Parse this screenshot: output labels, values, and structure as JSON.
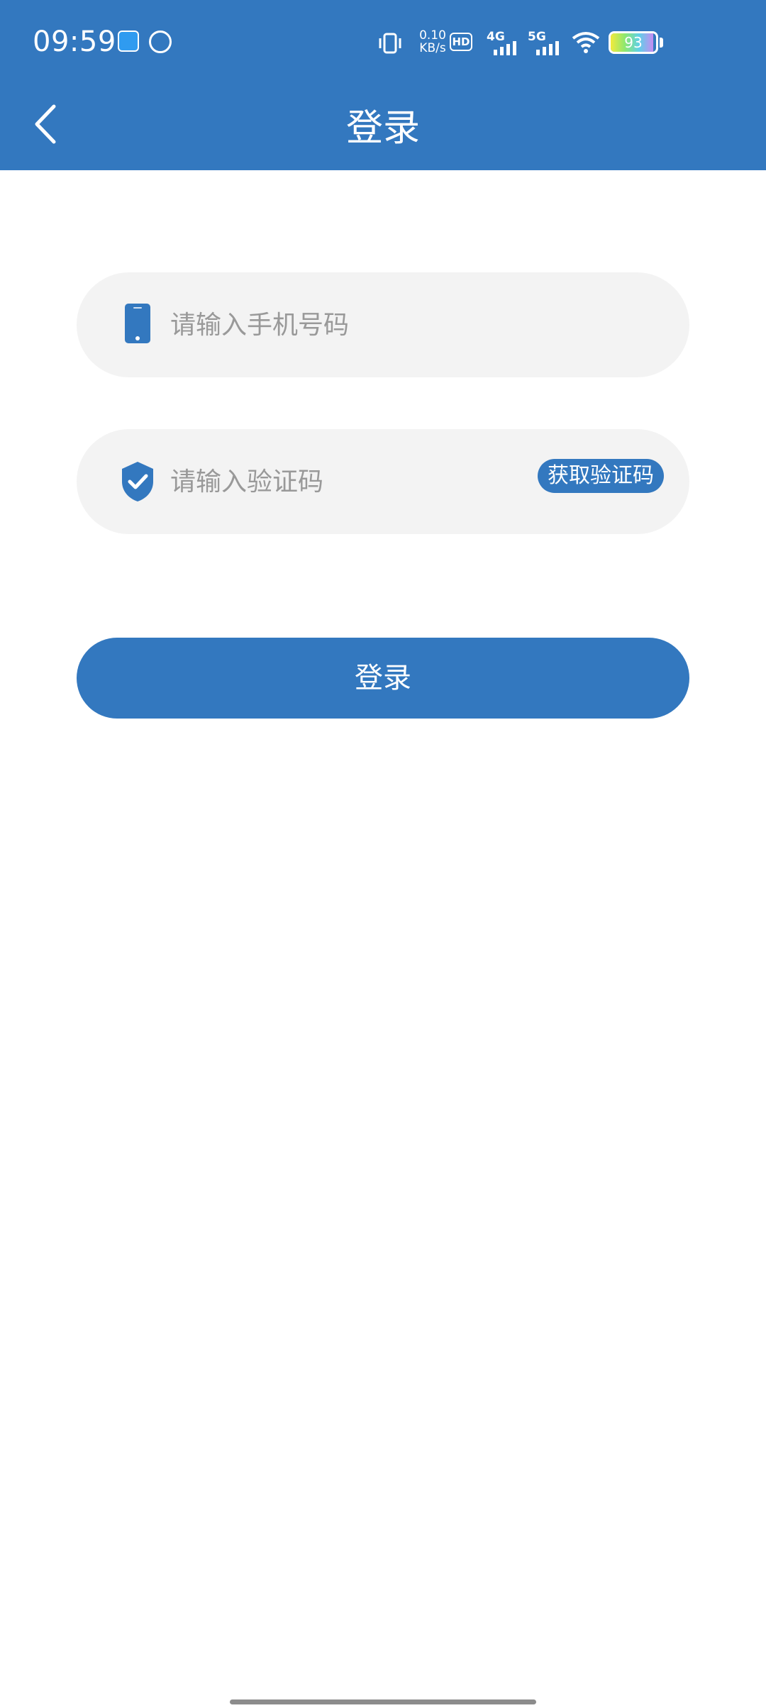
{
  "status_bar": {
    "time": "09:59",
    "net_speed_top": "0.10",
    "net_speed_bottom": "KB/s",
    "hd_label": "HD",
    "sig1_label": "4G",
    "sig2_label": "5G",
    "battery_level": "93",
    "icons": [
      "app-notification-icon",
      "app-notification-icon-2",
      "vibrate-icon",
      "signal-icon",
      "wifi-icon",
      "battery-icon"
    ]
  },
  "header": {
    "title": "登录",
    "back_icon": "chevron-left-icon"
  },
  "form": {
    "phone_placeholder": "请输入手机号码",
    "phone_icon": "phone-icon",
    "code_placeholder": "请输入验证码",
    "code_icon": "shield-check-icon",
    "get_code_label": "获取验证码",
    "login_label": "登录"
  },
  "colors": {
    "accent": "#3378bf",
    "input_bg": "#f3f3f3",
    "placeholder": "#999999"
  }
}
